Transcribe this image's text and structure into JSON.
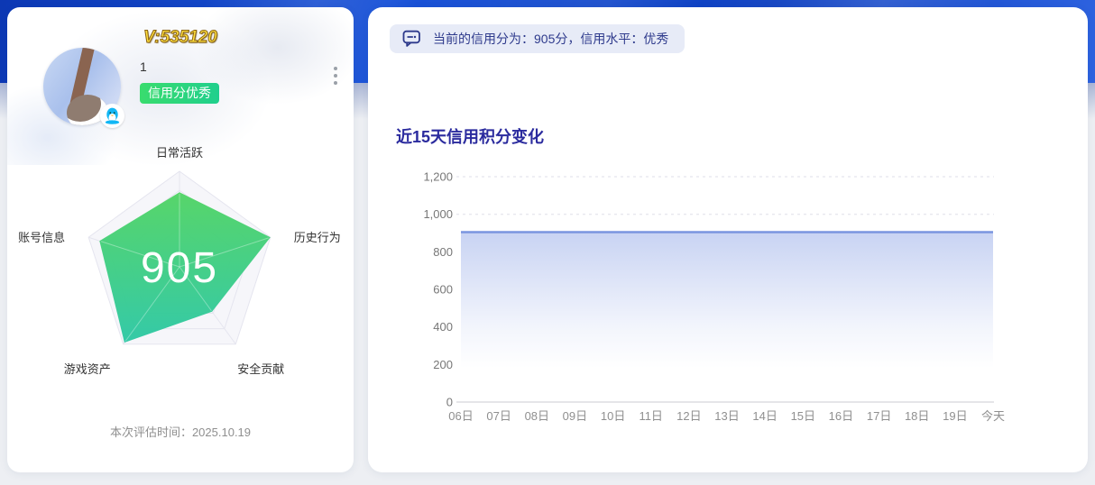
{
  "profile_card": {
    "avatar_tag": "V:535120",
    "nickname": "1",
    "badge_label": "信用分优秀",
    "score": "905",
    "eval_time": "本次评估时间：2025.10.19"
  },
  "score_panel": {
    "notice": "当前的信用分为：905分，信用水平：优秀",
    "chart_title": "近15天信用积分变化"
  },
  "icons": {
    "notice_icon": "comment-bubble-icon",
    "avatar_badge": "qq-penguin-icon",
    "menu": "kebab-menu-icon"
  },
  "colors": {
    "banner_blue": "#1245cb",
    "badge_green_start": "#39dc6e",
    "badge_green_end": "#20cf8d",
    "title_indigo": "#2b2b9e",
    "notice_bg": "#e7ebf7",
    "notice_text": "#2e3a8c",
    "line_blue": "#7a95e0",
    "radar_fill_top": "#52d465",
    "radar_fill_bottom": "#2ec8a5"
  },
  "chart_data": [
    {
      "type": "radar",
      "axes": [
        "日常活跃",
        "历史行为",
        "安全贡献",
        "游戏资产",
        "账号信息"
      ],
      "values_ratio": [
        0.78,
        1.0,
        0.58,
        0.98,
        0.88
      ],
      "center_value": "905",
      "rings": 5,
      "fill_gradient": [
        "#52d465",
        "#2ec8a5"
      ]
    },
    {
      "type": "area",
      "title": "近15天信用积分变化",
      "x": [
        "06日",
        "07日",
        "08日",
        "09日",
        "10日",
        "11日",
        "12日",
        "13日",
        "14日",
        "15日",
        "16日",
        "17日",
        "18日",
        "19日",
        "今天"
      ],
      "values": [
        905,
        905,
        905,
        905,
        905,
        905,
        905,
        905,
        905,
        905,
        905,
        905,
        905,
        905,
        905
      ],
      "ylim": [
        0,
        1200
      ],
      "yticks": [
        0,
        200,
        400,
        600,
        800,
        1000,
        1200
      ],
      "ytick_labels": [
        "0",
        "200",
        "400",
        "600",
        "800",
        "1,000",
        "1,200"
      ],
      "line_color": "#7a95e0",
      "area_color": "#7c96e2",
      "grid": "dotted, visible at 1,000 and 1,200 only",
      "legend": "none"
    }
  ]
}
